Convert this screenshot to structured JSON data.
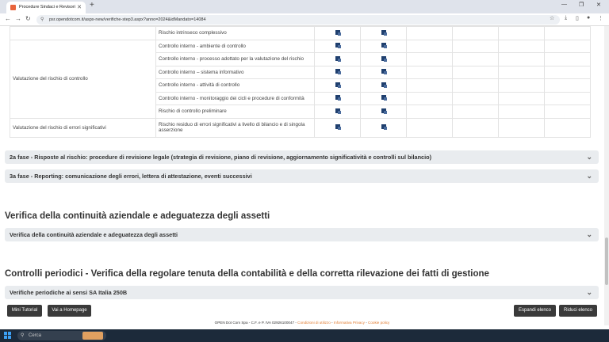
{
  "browser": {
    "tab_title": "Procedure Sindaci e Revisori",
    "url": "psr.opendotcom.it/aspx-new/verifiche-step3.aspx?anno=2024&idMandato=14084"
  },
  "risk_table": {
    "rows": [
      {
        "group": "",
        "item": "Rischio intrinseco complessivo"
      },
      {
        "group": "",
        "item": "Controllo interno - ambiente di controllo"
      },
      {
        "group": "",
        "item": "Controllo interno - processo adottato per la valutazione del rischio"
      },
      {
        "group": "Valutazione del rischio di controllo",
        "item": "Controllo interno – sistema informativo"
      },
      {
        "group": "",
        "item": "Controllo interno - attività di controllo"
      },
      {
        "group": "",
        "item": "Controllo interno - monitoraggio dei cicli e procedure di conformità"
      },
      {
        "group": "",
        "item": "Rischio di controllo preliminare"
      },
      {
        "group": "Valutazione del rischio di errori significativi",
        "item": "Rischio residuo di errori significativi a livello di bilancio e di singola asserzione"
      }
    ]
  },
  "accordions": {
    "fase2": "2a fase - Risposte al rischio: procedure di revisione legale (strategia di revisione, piano di revisione, aggiornamento significatività e controlli sul bilancio)",
    "fase3": "3a fase - Reporting: comunicazione degli errori, lettera di attestazione, eventi successivi",
    "continuita": "Verifica della continuità aziendale e adeguatezza degli assetti",
    "periodiche": "Verifiche periodiche ai sensi SA Italia 250B"
  },
  "sections": {
    "continuita_title": "Verifica della continuità aziendale e adeguatezza degli assetti",
    "controlli_title": "Controlli periodici - Verifica della regolare tenuta della contabilità e della corretta rilevazione dei fatti di gestione"
  },
  "buttons": {
    "mini_tutorial": "Mini Tutorial",
    "homepage": "Vai a Homepage",
    "expand": "Espandi elenco",
    "collapse": "Riduci elenco"
  },
  "footer": {
    "company": "OPEN Dot Com Spa - C.F. e P. IVA 02926100047 -",
    "terms": "Condizioni di utilizzo",
    "privacy": "Informativa Privacy",
    "cookie": "Cookie policy"
  },
  "taskbar": {
    "search_placeholder": "Cerca"
  },
  "icons": {
    "row_icon": "document-icon"
  }
}
